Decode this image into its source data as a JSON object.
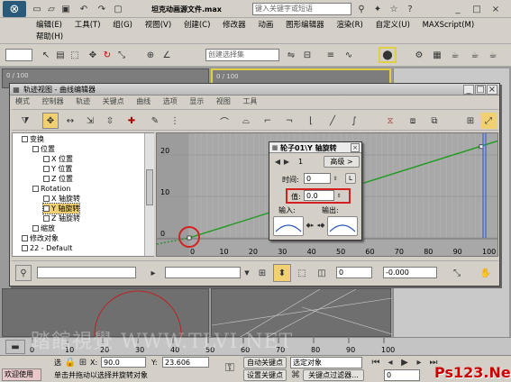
{
  "app": {
    "logo_glyph": "⊗",
    "title": "坦克动画源文件.max",
    "search_placeholder": "键入关键字或短语",
    "window_controls": [
      "_",
      "□",
      "×"
    ]
  },
  "main_menu": [
    "编辑(E)",
    "工具(T)",
    "组(G)",
    "视图(V)",
    "创建(C)",
    "修改器",
    "动画",
    "图形编辑器",
    "渲染(R)",
    "自定义(U)",
    "MAXScript(M)",
    "帮助(H)"
  ],
  "main_toolbar": {
    "selection_set_placeholder": "创建选择集"
  },
  "viewport_labels": {
    "tick_a": "0 / 100",
    "tick_b": "0 / 100"
  },
  "curve_editor": {
    "title": "轨迹视图 - 曲线编辑器",
    "menu": [
      "模式",
      "控制器",
      "轨迹",
      "关键点",
      "曲线",
      "选项",
      "显示",
      "视图",
      "工具"
    ],
    "window_controls": [
      "_",
      "□",
      "×"
    ],
    "tree": [
      {
        "label": "变换",
        "indent": 0
      },
      {
        "label": "位置",
        "indent": 1
      },
      {
        "label": "X 位置",
        "indent": 2
      },
      {
        "label": "Y 位置",
        "indent": 2
      },
      {
        "label": "Z 位置",
        "indent": 2
      },
      {
        "label": "Rotation",
        "indent": 1
      },
      {
        "label": "X 轴旋转",
        "indent": 2
      },
      {
        "label": "Y 轴旋转",
        "indent": 2,
        "selected": true
      },
      {
        "label": "Z 轴旋转",
        "indent": 2
      },
      {
        "label": "缩放",
        "indent": 1
      },
      {
        "label": "修改对象",
        "indent": 0
      },
      {
        "label": "22 - Default",
        "indent": 0
      }
    ],
    "y_ticks": [
      "20",
      "10",
      "0"
    ],
    "x_ticks": [
      "0",
      "10",
      "20",
      "30",
      "40",
      "50",
      "60",
      "70",
      "80",
      "90",
      "100"
    ],
    "bottom_left_value": "0",
    "bottom_right_value": "-0.000",
    "key_dialog": {
      "title": "轮子01\\Y 轴旋转",
      "key_number": "1",
      "advanced": "高级 >",
      "time_label": "时间:",
      "time_value": "0",
      "lock_label": "L",
      "value_label": "值:",
      "value": "0.0",
      "in_label": "输入:",
      "out_label": "输出:"
    }
  },
  "status": {
    "welcome": "欢迎使用",
    "selected_label": "选",
    "prompt": "单击并拖动以选择并旋转对象",
    "x_label": "X:",
    "x_value": "90.0",
    "y_label": "Y:",
    "y_value": "23.606",
    "auto_key": "自动关键点",
    "set_key": "设置关键点",
    "selected_object": "选定对象",
    "key_filters": "关键点过滤器...",
    "frame": "0"
  },
  "timeline": {
    "ticks": [
      "0",
      "10",
      "20",
      "30",
      "40",
      "50",
      "60",
      "70",
      "80",
      "90",
      "100"
    ],
    "watermark": "踏館視覺  WWW.TLVI.NET"
  },
  "brand": {
    "text": "Ps123.Net",
    "color": "#cc0000"
  },
  "colors": {
    "curve": "#1e9a1e",
    "highlight_red": "#d42020",
    "blue_line": "#3c64c8",
    "title_blue": "#0a246a"
  }
}
